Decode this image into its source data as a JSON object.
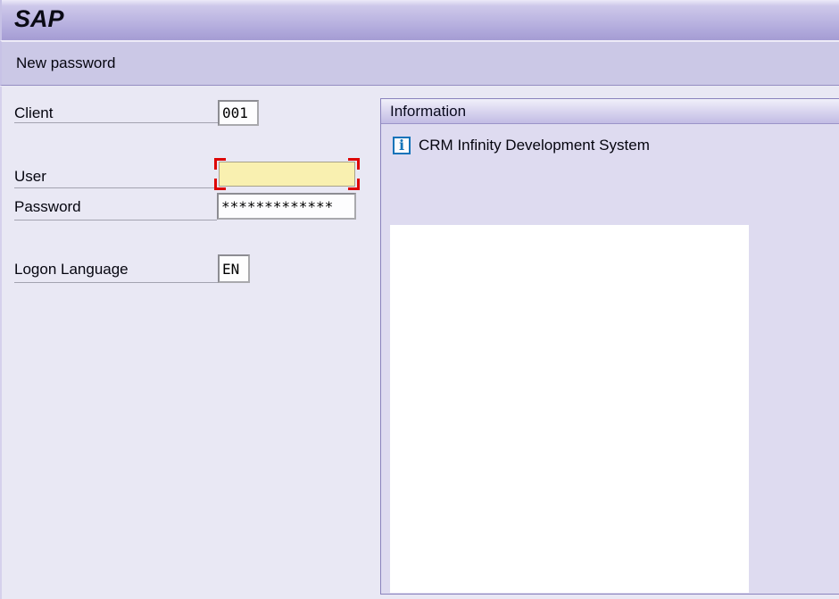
{
  "window": {
    "logo": "SAP"
  },
  "toolbar": {
    "new_password_label": "New password"
  },
  "form": {
    "client": {
      "label": "Client",
      "value": "001"
    },
    "user": {
      "label": "User",
      "value": ""
    },
    "password": {
      "label": "Password",
      "value": "*************"
    },
    "logon_language": {
      "label": "Logon Language",
      "value": "EN"
    }
  },
  "information_panel": {
    "title": "Information",
    "icon": "info-icon",
    "icon_glyph": "i",
    "message": "CRM Infinity Development System"
  },
  "colors": {
    "titlebar_gradient_top": "#eceaf8",
    "titlebar_gradient_bottom": "#a49cd3",
    "toolbar_bg": "#cbc8e6",
    "main_bg": "#e9e8f4",
    "panel_bg": "#dedbf0",
    "focus_field_bg": "#f9f0b0",
    "focus_corner_red": "#dd0604",
    "info_icon_blue": "#1273b9"
  }
}
